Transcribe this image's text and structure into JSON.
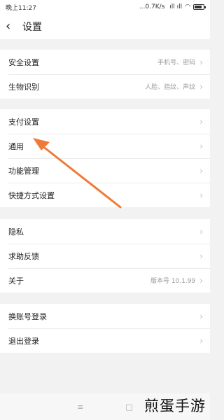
{
  "status_bar": {
    "time": "晚上11:27",
    "network": "...0.7K/s",
    "signal": " ıll ıll",
    "wifi_icon": "wifi-icon",
    "battery_level": 0.8
  },
  "header": {
    "back_icon": "chevron-left-icon",
    "title": "设置"
  },
  "groups": [
    {
      "items": [
        {
          "label": "安全设置",
          "value": "手机号、密码"
        },
        {
          "label": "生物识别",
          "value": "人脸、指纹、声纹"
        }
      ]
    },
    {
      "items": [
        {
          "label": "支付设置",
          "value": ""
        },
        {
          "label": "通用",
          "value": ""
        },
        {
          "label": "功能管理",
          "value": ""
        },
        {
          "label": "快捷方式设置",
          "value": ""
        }
      ]
    },
    {
      "items": [
        {
          "label": "隐私",
          "value": ""
        },
        {
          "label": "求助反馈",
          "value": ""
        },
        {
          "label": "关于",
          "value": "版本号 10.1.99"
        }
      ]
    },
    {
      "items": [
        {
          "label": "换账号登录",
          "value": ""
        },
        {
          "label": "退出登录",
          "value": ""
        }
      ]
    }
  ],
  "nav_bar": {
    "menu": "≡",
    "home": "□"
  },
  "watermark": "煎蛋手游",
  "colors": {
    "annotation_arrow": "#f07a35",
    "background": "#f2f2f2"
  }
}
